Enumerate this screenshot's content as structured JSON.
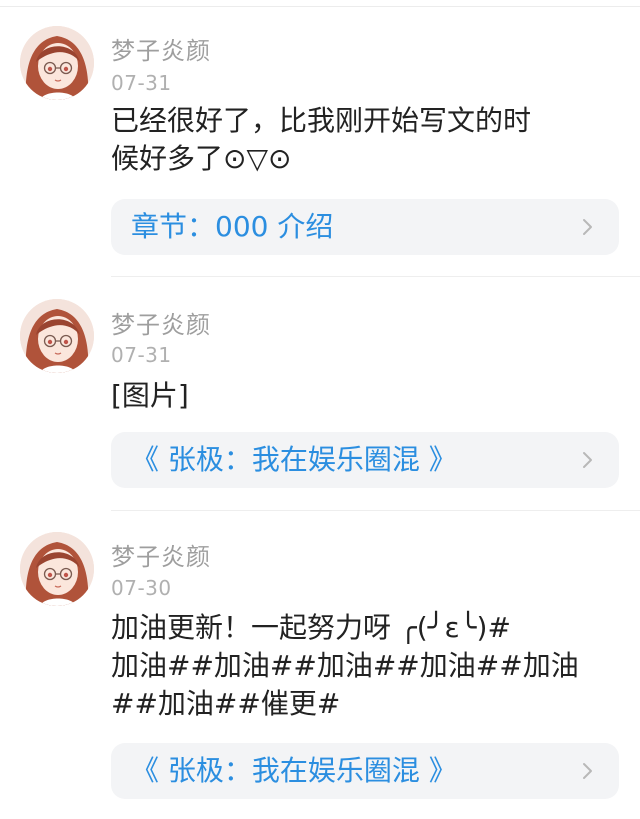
{
  "comments": [
    {
      "username": "梦子炎颜",
      "date": "07-31",
      "content_lines": [
        "已经很好了，比我刚开始写文的时",
        "候好多了⊙▽⊙"
      ],
      "link": "章节：000 介绍",
      "avatar_icon": "avatar-anime-girl-icon"
    },
    {
      "username": "梦子炎颜",
      "date": "07-31",
      "content_lines": [
        "[图片]"
      ],
      "link": "《 张极：我在娱乐圈混 》",
      "avatar_icon": "avatar-anime-girl-icon"
    },
    {
      "username": "梦子炎颜",
      "date": "07-30",
      "content_lines": [
        "加油更新！一起努力呀 ╭(╯ε╰)#",
        "加油##加油##加油##加油##加油",
        "##加油##催更#"
      ],
      "link": "《 张极：我在娱乐圈混 》",
      "avatar_icon": "avatar-anime-girl-icon"
    }
  ],
  "colors": {
    "link": "#2b8ee0",
    "username": "#9e9e9e",
    "card_bg": "#f3f4f6"
  }
}
